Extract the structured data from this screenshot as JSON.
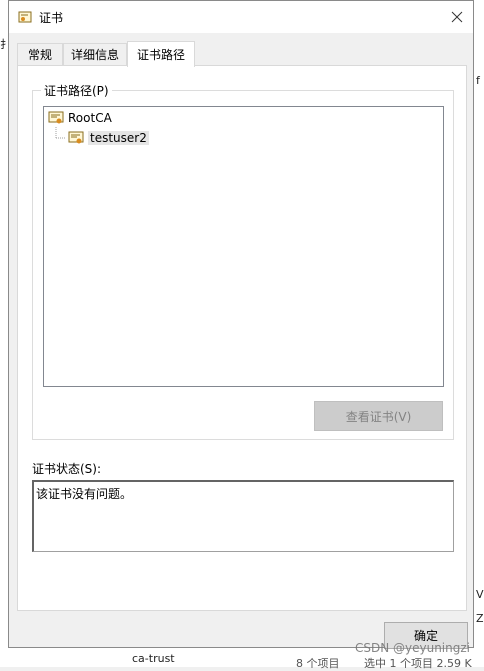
{
  "background": {
    "left_char": "玄",
    "left_char2": "扌",
    "right_char_top": "f",
    "right_char_mid": "V",
    "right_char_mid2": "Z",
    "right_char_bottom": "¢",
    "ca_trust": "ca-trust",
    "status_count": "8 个项目",
    "status_selected": "选中 1 个项目 2.59 K"
  },
  "dialog": {
    "title": "证书",
    "close_glyph": "×",
    "tabs": [
      {
        "label": "常规"
      },
      {
        "label": "详细信息"
      },
      {
        "label": "证书路径"
      }
    ],
    "path_group_label": "证书路径(P)",
    "tree": [
      {
        "label": "RootCA"
      },
      {
        "label": "testuser2"
      }
    ],
    "view_cert_button": "查看证书(V)",
    "status_label": "证书状态(S):",
    "status_text": "该证书没有问题。",
    "ok_button": "确定"
  },
  "watermark": "CSDN @yeyuningzi",
  "colors": {
    "dialog_bg": "#f0f0f0",
    "panel_bg": "#ffffff",
    "disabled_button": "#cccccc",
    "selected_node": "#e5e5e5"
  }
}
